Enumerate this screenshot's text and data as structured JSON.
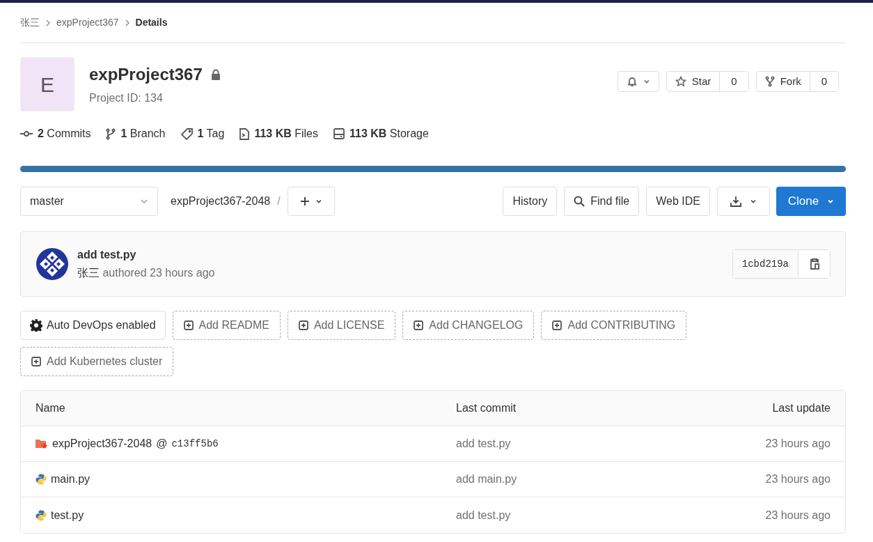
{
  "breadcrumbs": [
    {
      "label": "张三",
      "current": false
    },
    {
      "label": "expProject367",
      "current": false
    },
    {
      "label": "Details",
      "current": true
    }
  ],
  "project": {
    "avatar_letter": "E",
    "name": "expProject367",
    "private": true,
    "id_text": "Project ID: 134"
  },
  "header_buttons": {
    "star": {
      "label": "Star",
      "count": "0"
    },
    "fork": {
      "label": "Fork",
      "count": "0"
    }
  },
  "stats": [
    {
      "kind": "commits",
      "value": "2",
      "label": "Commits"
    },
    {
      "kind": "branch",
      "value": "1",
      "label": "Branch"
    },
    {
      "kind": "tag",
      "value": "1",
      "label": "Tag"
    },
    {
      "kind": "files",
      "value": "113 KB",
      "label": "Files"
    },
    {
      "kind": "storage",
      "value": "113 KB",
      "label": "Storage"
    }
  ],
  "toolbar": {
    "branch": "master",
    "path": "expProject367-2048",
    "separator": "/",
    "buttons": [
      "History",
      "Find file",
      "Web IDE"
    ],
    "clone": "Clone"
  },
  "last_commit": {
    "message": "add test.py",
    "author": "张三",
    "meta": "authored 23 hours ago",
    "sha": "1cbd219a"
  },
  "actions": [
    {
      "kind": "setting",
      "label": "Auto DevOps enabled"
    },
    {
      "kind": "add",
      "label": "Add README"
    },
    {
      "kind": "add",
      "label": "Add LICENSE"
    },
    {
      "kind": "add",
      "label": "Add CHANGELOG"
    },
    {
      "kind": "add",
      "label": "Add CONTRIBUTING"
    },
    {
      "kind": "add",
      "label": "Add Kubernetes cluster"
    }
  ],
  "table": {
    "columns": [
      "Name",
      "Last commit",
      "Last update"
    ],
    "rows": [
      {
        "kind": "submodule",
        "name": "expProject367-2048",
        "at": "@",
        "ref": "c13ff5b6",
        "last_commit": "add test.py",
        "last_update": "23 hours ago"
      },
      {
        "kind": "python",
        "name": "main.py",
        "last_commit": "add main.py",
        "last_update": "23 hours ago"
      },
      {
        "kind": "python",
        "name": "test.py",
        "last_commit": "add test.py",
        "last_update": "23 hours ago"
      }
    ]
  }
}
